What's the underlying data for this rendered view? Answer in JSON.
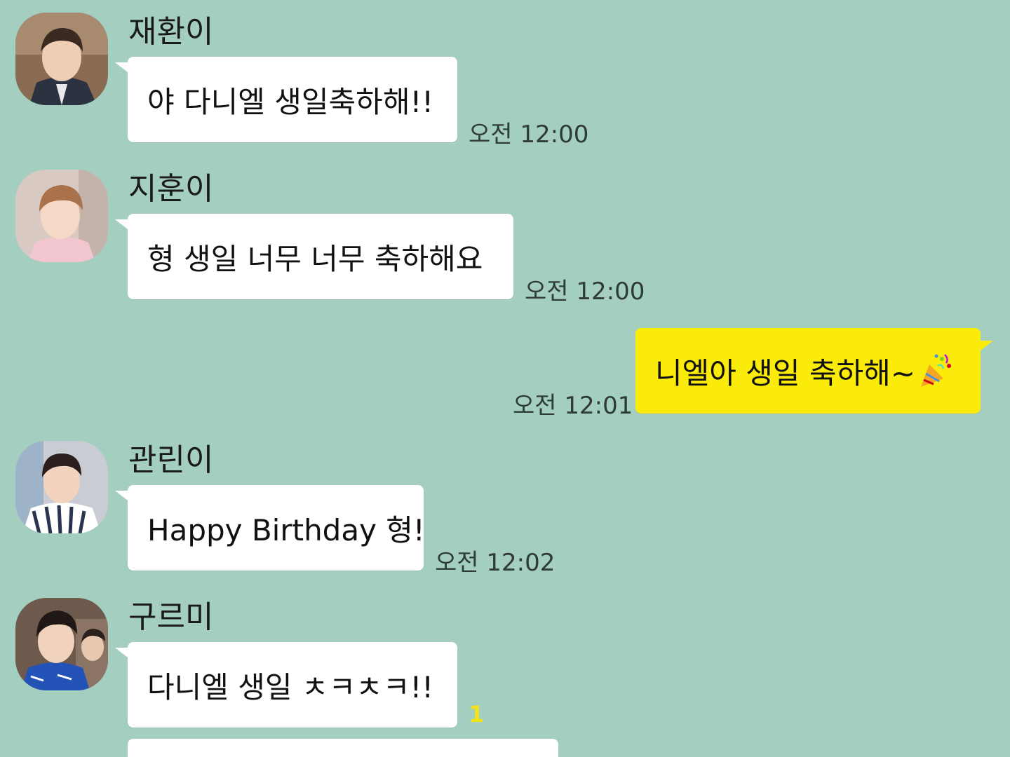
{
  "messages": [
    {
      "sender": "재환이",
      "text": "야 다니엘 생일축하해!!",
      "time": "오전 12:00"
    },
    {
      "sender": "지훈이",
      "text": "형 생일 너무 너무 축하해요",
      "time": "오전 12:00"
    },
    {
      "sender": "",
      "text": "니엘아 생일 축하해~",
      "time": "오전 12:01",
      "emoji": "party-popper-icon"
    },
    {
      "sender": "관린이",
      "text": "Happy Birthday 형!",
      "time": "오전 12:02"
    },
    {
      "sender": "구르미",
      "text": "다니엘 생일 ㅊㅋㅊㅋ!!",
      "unread": "1"
    }
  ],
  "colors": {
    "background": "#a4cebf",
    "incoming_bubble": "#ffffff",
    "outgoing_bubble": "#fbeb0b",
    "unread_count": "#f4e21a"
  }
}
